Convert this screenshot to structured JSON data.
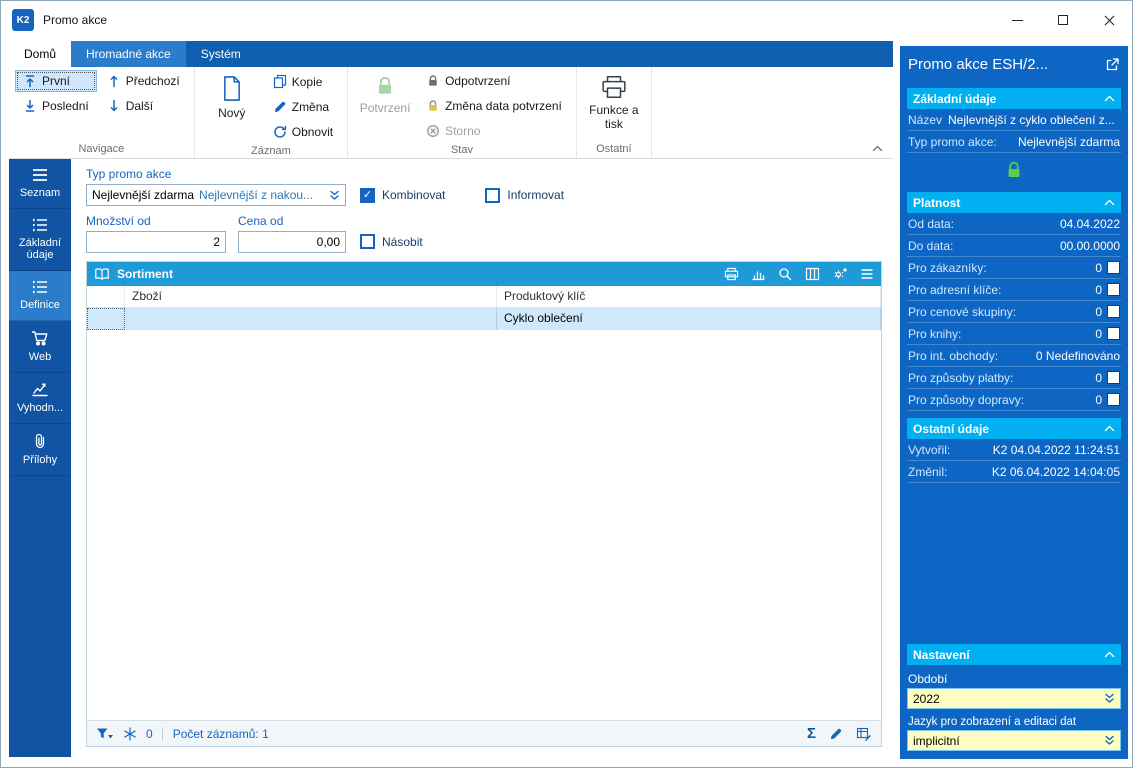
{
  "window": {
    "logo": "K2",
    "title": "Promo akce"
  },
  "tabs": {
    "home": "Domů",
    "bulk": "Hromadné akce",
    "system": "Systém"
  },
  "ribbon": {
    "navigace": {
      "label": "Navigace",
      "first": "První",
      "previous": "Předchozí",
      "last": "Poslední",
      "next": "Další"
    },
    "zaznam": {
      "label": "Záznam",
      "new": "Nový",
      "copy": "Kopie",
      "change": "Změna",
      "refresh": "Obnovit"
    },
    "stav": {
      "label": "Stav",
      "confirm": "Potvrzení",
      "unconfirm": "Odpotvrzení",
      "change_date": "Změna data potvrzení",
      "cancel": "Storno"
    },
    "ostatni": {
      "label": "Ostatní",
      "functions": "Funkce a tisk"
    }
  },
  "sidebar": {
    "items": [
      {
        "label": "Seznam"
      },
      {
        "label": "Základní údaje"
      },
      {
        "label": "Definice"
      },
      {
        "label": "Web"
      },
      {
        "label": "Vyhodn..."
      },
      {
        "label": "Přílohy"
      }
    ]
  },
  "form": {
    "typ_label": "Typ promo akce",
    "typ_value": "Nejlevnější zdarma",
    "typ_value_hint": "Nejlevnější z nakou...",
    "kombinovat": "Kombinovat",
    "informovat": "Informovat",
    "mnozstvi_label": "Množství od",
    "mnozstvi_value": "2",
    "cena_label": "Cena od",
    "cena_value": "0,00",
    "nasobit": "Násobit"
  },
  "grid": {
    "title": "Sortiment",
    "columns": [
      "Zboží",
      "Produktový klíč"
    ],
    "rows": [
      {
        "zbozi": "",
        "produktovy_klic": "Cyklo oblečení"
      }
    ],
    "status": {
      "filter_count": "0",
      "record_count": "Počet záznamů: 1"
    }
  },
  "right_panel": {
    "title": "Promo akce ESH/2...",
    "zakladni": {
      "header": "Základní údaje",
      "nazev_label": "Název",
      "nazev_value": "Nejlevnější z cyklo oblečení z...",
      "typ_label": "Typ promo akce:",
      "typ_value": "Nejlevnější zdarma"
    },
    "platnost": {
      "header": "Platnost",
      "rows": [
        {
          "label": "Od data:",
          "value": "04.04.2022",
          "checkbox": false
        },
        {
          "label": "Do data:",
          "value": "00.00.0000",
          "checkbox": false
        },
        {
          "label": "Pro zákazníky:",
          "value": "0",
          "checkbox": true
        },
        {
          "label": "Pro adresní klíče:",
          "value": "0",
          "checkbox": true
        },
        {
          "label": "Pro cenové skupiny:",
          "value": "0",
          "checkbox": true
        },
        {
          "label": "Pro knihy:",
          "value": "0",
          "checkbox": true
        },
        {
          "label": "Pro int. obchody:",
          "value": "0 Nedefinováno",
          "checkbox": false
        },
        {
          "label": "Pro způsoby platby:",
          "value": "0",
          "checkbox": true
        },
        {
          "label": "Pro způsoby dopravy:",
          "value": "0",
          "checkbox": true
        }
      ]
    },
    "ostatni": {
      "header": "Ostatní údaje",
      "rows": [
        {
          "label": "Vytvořil:",
          "value": "K2 04.04.2022 11:24:51"
        },
        {
          "label": "Změnil:",
          "value": "K2 06.04.2022 14:04:05"
        }
      ]
    },
    "nastaveni": {
      "header": "Nastavení",
      "obdobi_label": "Období",
      "obdobi_value": "2022",
      "jazyk_label": "Jazyk pro zobrazení a editaci dat",
      "jazyk_value": "implicitní"
    }
  },
  "icons": {
    "sigma": "Σ",
    "check": "✓"
  },
  "colors": {
    "accent_blue": "#1565c0",
    "tab_bar_blue": "#0f5fae",
    "sidebar_blue": "#1254a4",
    "sidebar_active_blue": "#2b7ccb",
    "panel_blue": "#0e66c4",
    "section_cyan": "#00b0f0",
    "grid_header_blue": "#1e9ad6",
    "selected_row": "#cfe9fb",
    "combo_yellow": "#ffffc4",
    "lock_green": "#4caf50"
  }
}
